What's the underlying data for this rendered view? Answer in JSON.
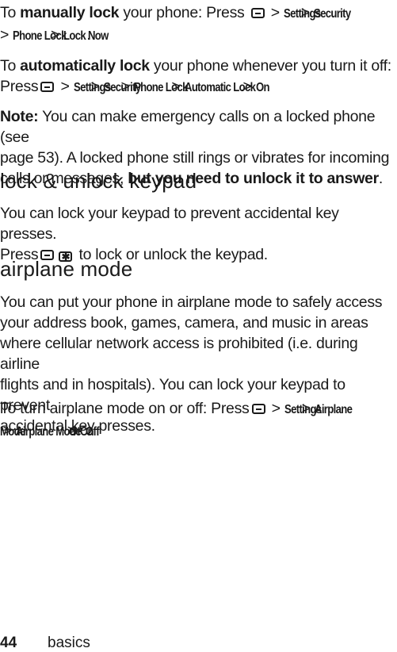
{
  "icons": {
    "menu_key": "menu-key-icon",
    "star_key": "star-key-icon"
  },
  "para1": {
    "to": "To ",
    "bold": "manually lock",
    "rest": " your phone: Press",
    "sep": " > ",
    "path": [
      "Settings",
      "Security",
      "Phone Lock",
      "Lock Now"
    ],
    "end": "."
  },
  "para2": {
    "to": "To ",
    "bold": "automatically lock",
    "rest": " your phone whenever you turn it off:",
    "press": "Press",
    "sep": " > ",
    "path": [
      "Settings",
      "Security",
      "Phone Lock",
      "Automatic Lock",
      "On"
    ],
    "end": "."
  },
  "note": {
    "label": "Note:",
    "line1": " You can make emergency calls on a locked phone (see",
    "line2": "page 53). A locked phone still rings or vibrates for incoming",
    "line3a": "calls or messages, ",
    "line3b": "but you need to unlock it to answer",
    "line3c": "."
  },
  "heading1": "lock & unlock keypad",
  "keypad": {
    "line1": "You can lock your keypad to prevent accidental key presses.",
    "press": "Press",
    "rest": " to lock or unlock the keypad."
  },
  "heading2": "airplane mode",
  "airplane": {
    "lines": [
      "You can put your phone in airplane mode to safely access",
      "your address book, games, camera, and music in areas",
      "where cellular network access is prohibited (i.e. during airline",
      "flights and in hospitals). You can lock your keypad to prevent",
      "accidental key presses."
    ],
    "toggle_intro": "To turn airplane mode on or off: Press",
    "sep": " > ",
    "path1": "Settings",
    "path2a": "Airplane",
    "path2b": "Mode",
    "path3": "Airplane Mode",
    "on": "On",
    "or": " or ",
    "off": "Off",
    "end": "."
  },
  "footer": {
    "page": "44",
    "section": "basics"
  }
}
